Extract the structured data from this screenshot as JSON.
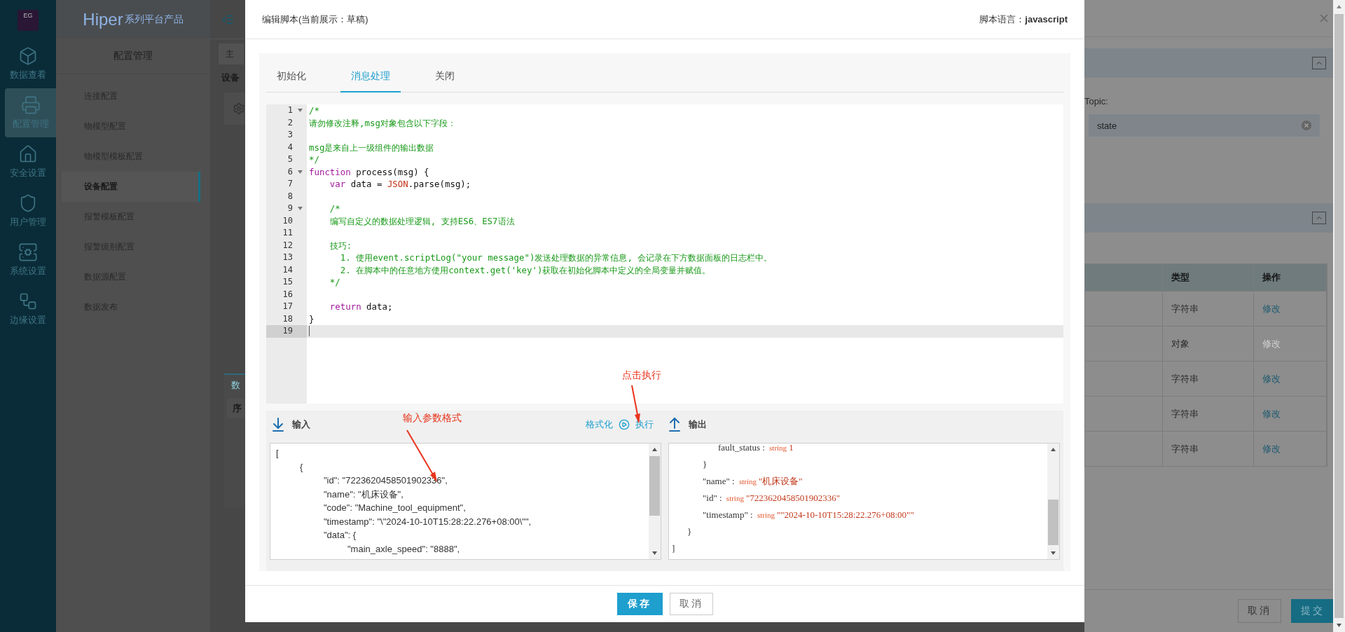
{
  "sidebar": {
    "logo": "EG",
    "items": [
      {
        "label": "数据查看",
        "selected": false
      },
      {
        "label": "配置管理",
        "selected": true
      },
      {
        "label": "安全设置",
        "selected": false
      },
      {
        "label": "用户管理",
        "selected": false
      },
      {
        "label": "系统设置",
        "selected": false
      },
      {
        "label": "边缘设置",
        "selected": false
      }
    ]
  },
  "brand": {
    "name": "Hiper",
    "suffix": "系列平台产品"
  },
  "nav": {
    "title": "配置管理",
    "items": [
      {
        "label": "连接配置",
        "selected": false
      },
      {
        "label": "物模型配置",
        "selected": false
      },
      {
        "label": "物模型模板配置",
        "selected": false
      },
      {
        "label": "设备配置",
        "selected": true
      },
      {
        "label": "报警模板配置",
        "selected": false
      },
      {
        "label": "报警级别配置",
        "selected": false
      },
      {
        "label": "数据源配置",
        "selected": false
      },
      {
        "label": "数据发布",
        "selected": false
      }
    ]
  },
  "page": {
    "tab": "主",
    "heading": "设备",
    "subtab": "数",
    "column": "序"
  },
  "drawer": {
    "topic_label": "Topic:",
    "topic_value": "state",
    "columns": [
      "类型",
      "操作"
    ],
    "rows": [
      {
        "type": "字符串",
        "action": "修改",
        "disabled": false
      },
      {
        "type": "对象",
        "action": "修改",
        "disabled": true
      },
      {
        "type": "字符串",
        "action": "修改",
        "disabled": false
      },
      {
        "type": "字符串",
        "action": "修改",
        "disabled": false
      },
      {
        "type": "字符串",
        "action": "修改",
        "disabled": false
      }
    ],
    "buttons": [
      {
        "label": "取消",
        "kind": "default"
      },
      {
        "label": "提交",
        "kind": "primary"
      }
    ]
  },
  "modal": {
    "title": "编辑脚本(当前展示：草稿)",
    "language_label": "脚本语言：",
    "language": "javascript",
    "tabs": [
      {
        "label": "初始化",
        "selected": false
      },
      {
        "label": "消息处理",
        "selected": true
      },
      {
        "label": "关闭",
        "selected": false
      }
    ],
    "code": [
      {
        "number": "1",
        "fold": true,
        "active": false,
        "tokens": [
          {
            "kind": "comment",
            "text": "/*"
          }
        ]
      },
      {
        "number": "2",
        "fold": false,
        "active": false,
        "tokens": [
          {
            "kind": "comment",
            "text": "请勿修改注释,msg对象包含以下字段："
          }
        ]
      },
      {
        "number": "3",
        "fold": false,
        "active": false
      },
      {
        "number": "4",
        "fold": false,
        "active": false,
        "tokens": [
          {
            "kind": "comment",
            "text": "msg是来自上一级组件的输出数据"
          }
        ]
      },
      {
        "number": "5",
        "fold": false,
        "active": false,
        "tokens": [
          {
            "kind": "comment",
            "text": "*/"
          }
        ]
      },
      {
        "number": "6",
        "fold": true,
        "active": false,
        "tokens": [
          {
            "kind": "keyword",
            "text": "function"
          },
          {
            "kind": "plain",
            "text": " process(msg) {"
          }
        ]
      },
      {
        "number": "7",
        "fold": false,
        "active": false,
        "tokens": [
          {
            "kind": "keyword",
            "text": "    var"
          },
          {
            "kind": "plain",
            "text": " data = "
          },
          {
            "kind": "builtin",
            "text": "JSON"
          },
          {
            "kind": "plain",
            "text": ".parse(msg);"
          }
        ]
      },
      {
        "number": "8",
        "fold": false,
        "active": false
      },
      {
        "number": "9",
        "fold": true,
        "active": false,
        "tokens": [
          {
            "kind": "comment",
            "text": "    /*"
          }
        ]
      },
      {
        "number": "10",
        "fold": false,
        "active": false,
        "tokens": [
          {
            "kind": "comment",
            "text": "    编写自定义的数据处理逻辑, 支持ES6、ES7语法"
          }
        ]
      },
      {
        "number": "11",
        "fold": false,
        "active": false
      },
      {
        "number": "12",
        "fold": false,
        "active": false,
        "tokens": [
          {
            "kind": "comment",
            "text": "    技巧:"
          }
        ]
      },
      {
        "number": "13",
        "fold": false,
        "active": false,
        "tokens": [
          {
            "kind": "comment",
            "text": "      1. 使用event.scriptLog(\"your message\")发送处理数据的异常信息, 会记录在下方数据面板的日志栏中。"
          }
        ]
      },
      {
        "number": "14",
        "fold": false,
        "active": false,
        "tokens": [
          {
            "kind": "comment",
            "text": "      2. 在脚本中的任意地方使用context.get('key')获取在初始化脚本中定义的全局变量并赋值。"
          }
        ]
      },
      {
        "number": "15",
        "fold": false,
        "active": false,
        "tokens": [
          {
            "kind": "comment",
            "text": "    */"
          }
        ]
      },
      {
        "number": "16",
        "fold": false,
        "active": false
      },
      {
        "number": "17",
        "fold": false,
        "active": false,
        "tokens": [
          {
            "kind": "keyword",
            "text": "    return"
          },
          {
            "kind": "plain",
            "text": " data;"
          }
        ]
      },
      {
        "number": "18",
        "fold": false,
        "active": false,
        "tokens": [
          {
            "kind": "plain",
            "text": "}"
          }
        ]
      },
      {
        "number": "19",
        "fold": false,
        "active": true
      }
    ],
    "input_label": "输入",
    "format_link": "格式化",
    "run_link": "执行",
    "output_label": "输出",
    "input_lines": [
      "[",
      "\t{",
      "\t\t\"id\": \"7223620458501902336\",",
      "\t\t\"name\": \"机床设备\",",
      "\t\t\"code\": \"Machine_tool_equipment\",",
      "\t\t\"timestamp\": \"\\\"2024-10-10T15:28:22.276+08:00\\\"\",",
      "\t\t\"data\": {",
      "\t\t\t\"main_axle_speed\": \"8888\","
    ],
    "output": {
      "close": "]",
      "children": [
        {
          "close": "}",
          "children": [
            {
              "close": "}",
              "children": [
                {
                  "key": "fault_status",
                  "sep": ":",
                  "type": "string",
                  "value": "1"
                }
              ]
            },
            {
              "key": "\"name\"",
              "sep": ":",
              "type": "string",
              "value": "\"机床设备\""
            },
            {
              "key": "\"id\"",
              "sep": ":",
              "type": "string",
              "value": "\"7223620458501902336\""
            },
            {
              "key": "\"timestamp\"",
              "sep": ":",
              "type": "string",
              "value": "\"\"2024-10-10T15:28:22.276+08:00\"\""
            }
          ]
        }
      ]
    },
    "annotations": [
      {
        "text": "点击执行"
      },
      {
        "text": "输入参数格式"
      }
    ],
    "buttons": [
      {
        "label": "保存",
        "kind": "primary"
      },
      {
        "label": "取消",
        "kind": "default"
      }
    ]
  }
}
